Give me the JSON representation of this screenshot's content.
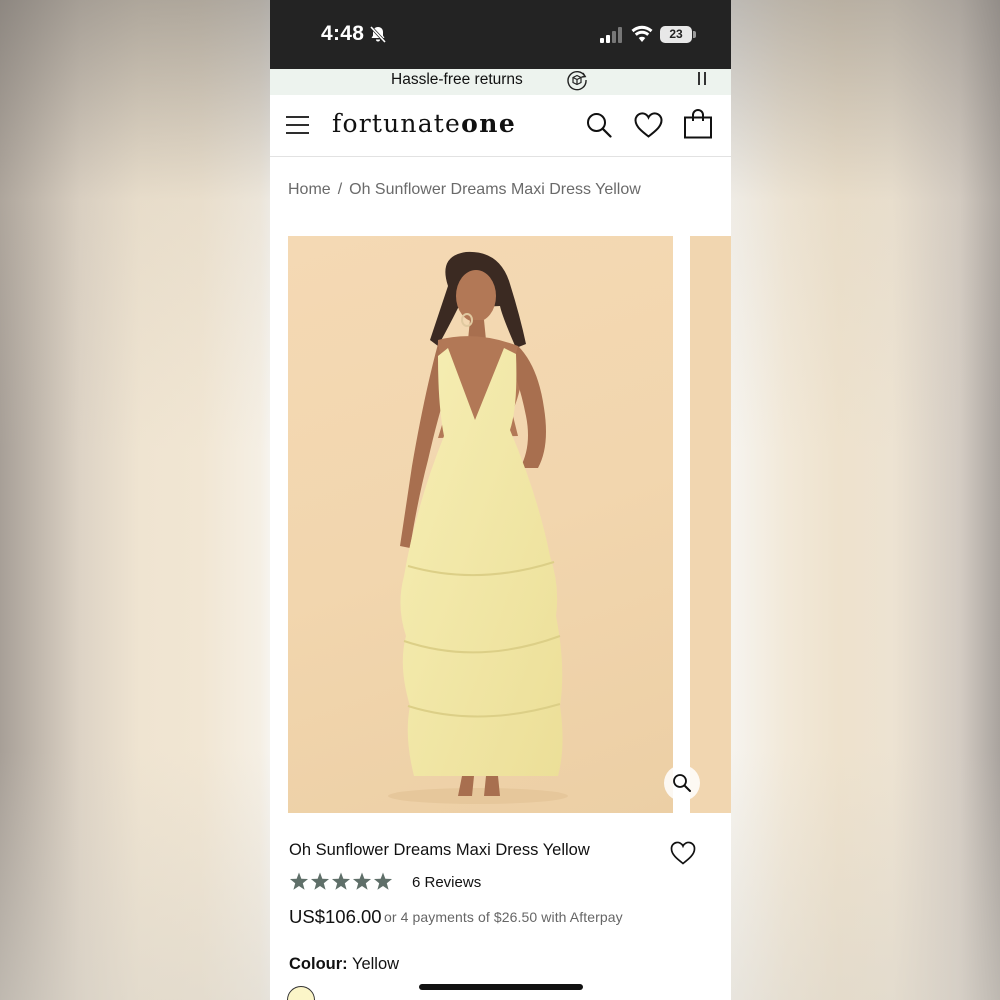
{
  "status_bar": {
    "time": "4:48",
    "battery": "23"
  },
  "promo": {
    "text": "Hassle-free returns"
  },
  "header": {
    "logo_light": "fortunate",
    "logo_bold": "one"
  },
  "breadcrumb": {
    "home": "Home",
    "separator": "/",
    "current": "Oh Sunflower Dreams Maxi Dress Yellow"
  },
  "product": {
    "title": "Oh Sunflower Dreams Maxi Dress Yellow",
    "rating": 5,
    "reviews": "6 Reviews",
    "price": "US$106.00",
    "afterpay": "or 4 payments of $26.50 with Afterpay",
    "colour_label": "Colour:",
    "colour_value": "Yellow"
  },
  "colors": {
    "status_bar": "#232323",
    "promo_bg": "#edf3ee",
    "star": "#5f6f69",
    "photo_bg": "#f2d6ae",
    "dress": "#f3eaaa"
  },
  "icons": [
    "bell-slash-icon",
    "signal-icon",
    "wifi-icon",
    "box-return-icon",
    "menu-icon",
    "search-icon",
    "heart-icon",
    "shopping-bag-icon",
    "zoom-icon",
    "star-icon"
  ]
}
